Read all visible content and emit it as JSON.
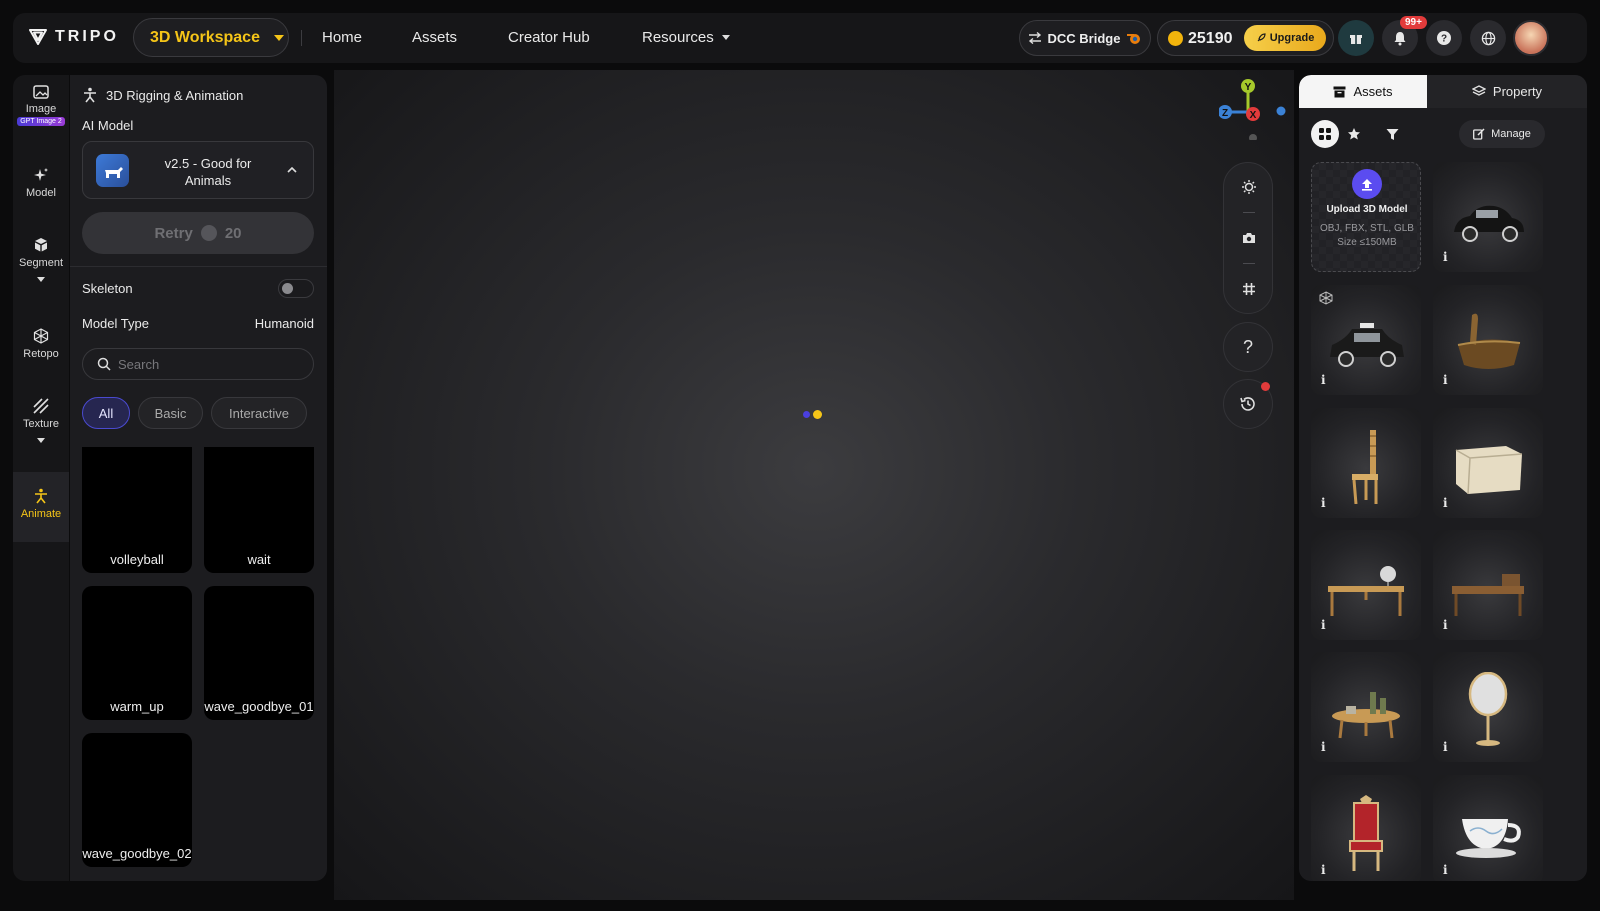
{
  "header": {
    "logo_text": "TRIPO",
    "workspace_label": "3D Workspace",
    "nav": [
      "Home",
      "Assets",
      "Creator Hub",
      "Resources"
    ],
    "dcc_label": "DCC Bridge",
    "credits": "25190",
    "upgrade_label": "Upgrade",
    "notification_badge": "99+"
  },
  "rail": {
    "image": "Image",
    "gpt_tag": "GPT Image 2",
    "model": "Model",
    "segment": "Segment",
    "retopo": "Retopo",
    "texture": "Texture",
    "animate": "Animate"
  },
  "panel": {
    "title": "3D Rigging & Animation",
    "ai_model_label": "AI Model",
    "model_name": "v2.5 - Good for Animals",
    "retry_label": "Retry",
    "retry_cost": "20",
    "skeleton_label": "Skeleton",
    "model_type_label": "Model Type",
    "model_type_value": "Humanoid",
    "search_placeholder": "Search",
    "filters": [
      "All",
      "Basic",
      "Interactive"
    ],
    "animations": [
      "volleyball",
      "wait",
      "warm_up",
      "wave_goodbye_01",
      "wave_goodbye_02"
    ]
  },
  "viewport": {
    "axis_labels": {
      "y": "Y",
      "z": "Z",
      "x": "X"
    },
    "help_symbol": "?"
  },
  "assets_panel": {
    "tab_assets": "Assets",
    "tab_property": "Property",
    "manage_label": "Manage",
    "upload_title": "Upload 3D Model",
    "upload_formats": "OBJ, FBX, STL, GLB",
    "upload_size": "Size ≤150MB",
    "info_symbol": "i",
    "items": [
      "vintage car",
      "taxi car",
      "wooden boat",
      "wooden chair",
      "storage crate",
      "desk with globe",
      "writing desk",
      "side table with bottles",
      "standing mirror",
      "red throne chair",
      "teacup"
    ]
  },
  "colors": {
    "accent_yellow": "#f5c518",
    "accent_purple": "#5b4cf0",
    "panel_bg": "#1c1c1f"
  }
}
